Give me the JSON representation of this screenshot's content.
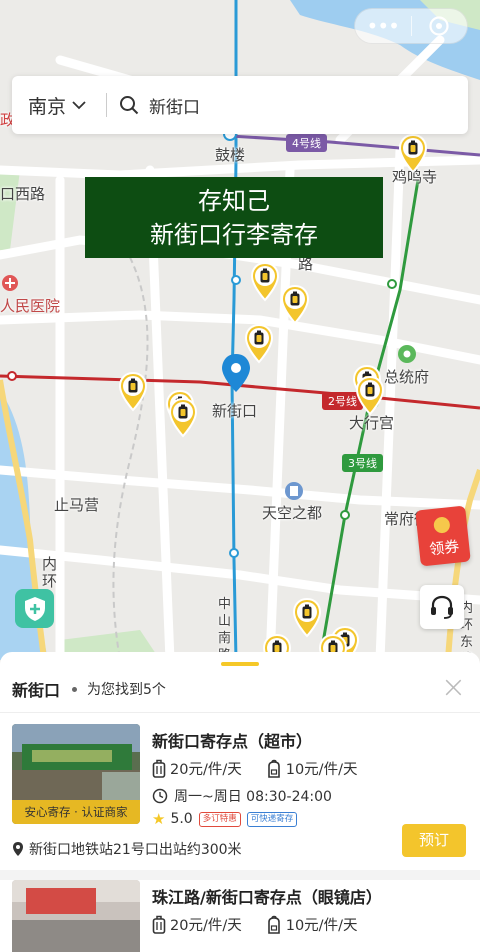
{
  "capsule": {
    "more_icon": "more-dots-icon",
    "close_icon": "miniapp-close-icon"
  },
  "search": {
    "city": "南京",
    "query": "新街口"
  },
  "banner": {
    "line1": "存知己",
    "line2": "新街口行李寄存"
  },
  "map": {
    "labels": {
      "gulou": "鼓楼",
      "jimingsi": "鸡鸣寺",
      "xilu": "口西路",
      "hospital": "人民医院",
      "road_lu": "路",
      "zongtongfu": "总统府",
      "xinjiekou": "新街口",
      "daxinggong": "大行宫",
      "zhimaying": "止马营",
      "tiankong": "天空之都",
      "changfu": "常府街",
      "neihuan": "内环",
      "zhongshan_nan": "中山南路",
      "east": "内环东线",
      "gu": "政"
    },
    "lines": {
      "line4": "4号线",
      "line2": "2号线",
      "line3": "3号线"
    },
    "colors": {
      "line2": "#c4282c",
      "line3": "#2f9a3e",
      "line4": "#7b5aa6",
      "line1": "#2a9ad6"
    }
  },
  "floating": {
    "coupon": "领券"
  },
  "sheet": {
    "title": "新街口",
    "count_text": "为您找到5个",
    "close": "×"
  },
  "cards": [
    {
      "name": "新街口寄存点（超市）",
      "thumb_tag": "安心寄存 · 认证商家",
      "price_large": "20元/件/天",
      "price_small": "10元/件/天",
      "hours": "周一~周日 08:30-24:00",
      "rating": "5.0",
      "badge1": "多订特惠",
      "badge2": "可快递寄存",
      "location": "新街口地铁站21号口出站约300米",
      "book": "预订"
    },
    {
      "name": "珠江路/新街口寄存点（眼镜店）",
      "price_large": "20元/件/天",
      "price_small": "10元/件/天"
    }
  ],
  "accent": "#f3c52c"
}
